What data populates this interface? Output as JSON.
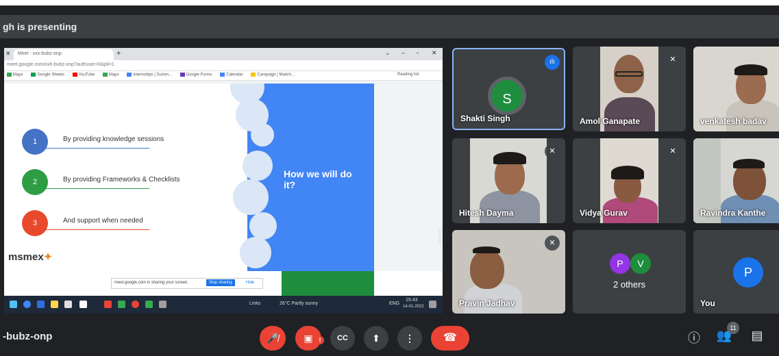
{
  "header": {
    "presenting_text": "gh is presenting"
  },
  "browser": {
    "tab_label": "Meet - xxx-bubz-onp",
    "address": "meet.google.com/xxh-bubz-onp?authuser=0&pli=1",
    "bookmarks": [
      "Maps",
      "Google Sheets",
      "YouTube",
      "Maps",
      "Internships | Summ...",
      "Google Forms",
      "Calendar",
      "Campaign | Mailch..."
    ],
    "reading_list": "Reading list"
  },
  "slide": {
    "heading": "How we will do it?",
    "items": [
      {
        "number": "1",
        "text": "By providing knowledge sessions",
        "color": "#4472c4"
      },
      {
        "number": "2",
        "text": "By providing Frameworks & Checklists",
        "color": "#2e9e44"
      },
      {
        "number": "3",
        "text": "And support when needed",
        "color": "#e8492c"
      }
    ],
    "logo": "msmex"
  },
  "share_notice": {
    "text": "meet.google.com is sharing your screen.",
    "stop_label": "Stop sharing",
    "hide_label": "Hide"
  },
  "taskbar": {
    "search": "Links",
    "weather": "26°C  Partly sunny",
    "lang": "ENG",
    "time": "15:43",
    "date": "14-01-2022"
  },
  "participants": [
    {
      "name": "Shakti Singh",
      "initial": "S",
      "speaking": true,
      "avatar_color": "#1e8e3e"
    },
    {
      "name": "Amol Ganapate",
      "muted": true
    },
    {
      "name": "venkatesh badav"
    },
    {
      "name": "Hitesh Dayma",
      "muted": true
    },
    {
      "name": "Vidya Gurav",
      "muted": true
    },
    {
      "name": "Ravindra Kanthe"
    },
    {
      "name": "Pravin Jadhav",
      "muted": true
    }
  ],
  "others_tile": {
    "label": "2 others",
    "initials": [
      "P",
      "V"
    ],
    "colors": [
      "#9334e6",
      "#1e8e3e"
    ]
  },
  "you_tile": {
    "label": "You",
    "initial": "P",
    "color": "#1a73e8"
  },
  "bottom": {
    "meeting_code": "-bubz-onp",
    "people_count": "11",
    "warning": "!",
    "icons": [
      "mic-off-icon",
      "camera-off-icon",
      "captions-icon",
      "present-icon",
      "more-icon",
      "end-call-icon",
      "info-icon",
      "people-icon",
      "chat-icon"
    ]
  }
}
